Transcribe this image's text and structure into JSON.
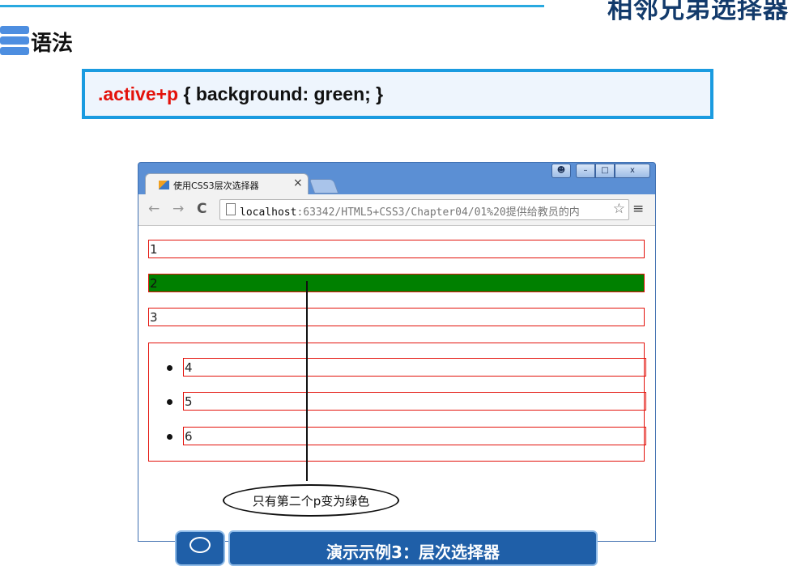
{
  "slide": {
    "title": "相邻兄弟选择器",
    "section_label": "语法",
    "code": {
      "selector": ".active+p",
      "rest": " {  background: green;  }"
    }
  },
  "browser": {
    "tab_title": "使用CSS3层次选择器",
    "tab_close": "×",
    "window_buttons": {
      "close": "x"
    },
    "url_host": "localhost",
    "url_rest": ":63342/HTML5+CSS3/Chapter04/01%20提供给教员的内",
    "star": "☆",
    "menu": "≡",
    "nav_back": "←",
    "nav_forward": "→",
    "nav_reload": "C"
  },
  "page": {
    "paragraphs": [
      "1",
      "2",
      "3"
    ],
    "list_items": [
      "4",
      "5",
      "6"
    ],
    "highlight_color": "#008000"
  },
  "annotation": "只有第二个p变为绿色",
  "footer_button": "演示示例3：层次选择器",
  "colors": {
    "accent": "#29a9e0",
    "code_border": "#1a9be0",
    "selector_red": "#e3120b",
    "browser_frame": "#5b8fd4"
  }
}
